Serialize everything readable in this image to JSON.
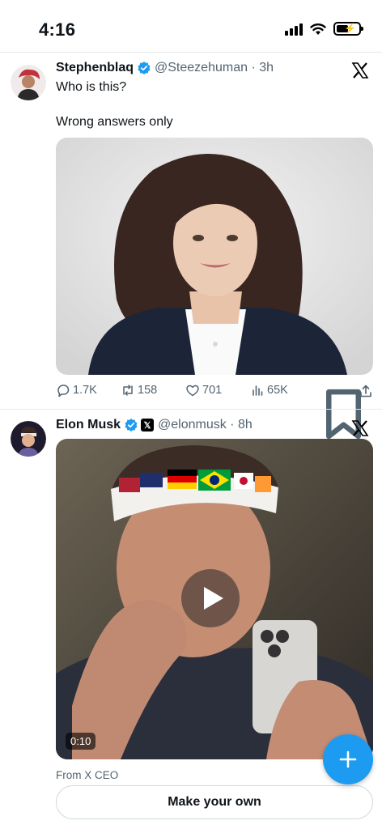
{
  "status_bar": {
    "time": "4:16",
    "battery_level": 0.55
  },
  "tweets": [
    {
      "author_name": "Stephenblaq",
      "handle_time": "@Steezehuman · 3h",
      "text_line1": "Who is this?",
      "text_line2": "Wrong answers only",
      "stats": {
        "replies": "1.7K",
        "reposts": "158",
        "likes": "701",
        "views": "65K"
      }
    },
    {
      "author_name": "Elon Musk",
      "handle_time": "@elonmusk · 8h",
      "video_duration": "0:10",
      "source_label": "From X CEO",
      "cta_label": "Make your own"
    }
  ],
  "colors": {
    "accent": "#1d9bf0",
    "text": "#0f1419",
    "muted": "#536471"
  },
  "icons": [
    "signal-icon",
    "wifi-icon",
    "battery-icon",
    "verified-badge-icon",
    "x-logo-icon",
    "reply-icon",
    "repost-icon",
    "like-icon",
    "views-icon",
    "bookmark-icon",
    "share-icon",
    "play-icon",
    "compose-plus-icon"
  ]
}
